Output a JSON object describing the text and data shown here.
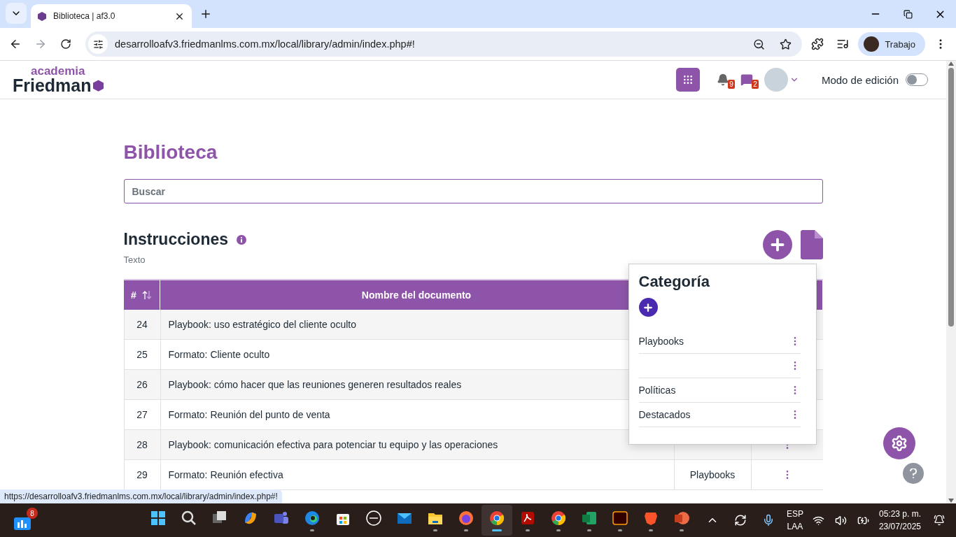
{
  "browser": {
    "tab_title": "Biblioteca | af3.0",
    "url": "desarrolloafv3.friedmanlms.com.mx/local/library/admin/index.php#!",
    "profile": "Trabajo"
  },
  "header": {
    "logo_top": "academia",
    "logo_main": "Friedman",
    "notifications": "9",
    "messages": "2",
    "edit_mode": {
      "label": "Modo de edición",
      "on": false
    }
  },
  "page": {
    "title": "Biblioteca",
    "search": {
      "placeholder": "Buscar"
    },
    "section": {
      "title": "Instrucciones",
      "subtitle": "Texto"
    }
  },
  "table": {
    "columns": [
      {
        "label": "#"
      },
      {
        "label": "Nombre del documento"
      }
    ],
    "rows": [
      {
        "number": "24",
        "name": "Playbook: uso estratégico del cliente oculto"
      },
      {
        "number": "25",
        "name": "Formato: Cliente oculto"
      },
      {
        "number": "26",
        "name": "Playbook: cómo hacer que las reuniones generen resultados reales"
      },
      {
        "number": "27",
        "name": "Formato: Reunión del punto de venta"
      },
      {
        "number": "28",
        "name": "Playbook: comunicación efectiva para potenciar tu equipo y las operaciones",
        "actions_menu": true
      },
      {
        "number": "29",
        "name": "Formato: Reunión efectiva",
        "category": "Playbooks",
        "actions_menu": true
      }
    ]
  },
  "category_popover": {
    "title": "Categoría",
    "items": [
      {
        "kind": "named",
        "label": "Playbooks"
      },
      {
        "kind": "blank"
      },
      {
        "kind": "named",
        "label": "Políticas"
      },
      {
        "kind": "named",
        "label": "Destacados"
      }
    ]
  },
  "status_link": "https://desarrolloafv3.friedmanlms.com.mx/local/library/admin/index.php#!",
  "taskbar": {
    "widgets_badge": "8",
    "language": [
      "ESP",
      "LAA"
    ],
    "time": "05:23 p. m.",
    "date": "23/07/2025",
    "apps": [
      {
        "kind": "windows",
        "running": false,
        "active": false
      },
      {
        "kind": "search",
        "running": false,
        "active": false
      },
      {
        "kind": "taskview",
        "running": false,
        "active": false
      },
      {
        "kind": "copilot",
        "running": false,
        "active": false
      },
      {
        "kind": "teams",
        "running": false,
        "active": false
      },
      {
        "kind": "edge",
        "running": true,
        "active": false
      },
      {
        "kind": "store",
        "running": false,
        "active": false
      },
      {
        "kind": "dell",
        "running": false,
        "active": false
      },
      {
        "kind": "mail",
        "running": false,
        "active": false
      },
      {
        "kind": "folder",
        "running": true,
        "active": false
      },
      {
        "kind": "firefox",
        "running": true,
        "active": false
      },
      {
        "kind": "chrome",
        "running": true,
        "active": true
      },
      {
        "kind": "pdf",
        "running": true,
        "active": false
      },
      {
        "kind": "chrome",
        "running": true,
        "active": false
      },
      {
        "kind": "excel",
        "running": true,
        "active": false
      },
      {
        "kind": "illustrator",
        "running": true,
        "active": false
      },
      {
        "kind": "brave",
        "running": true,
        "active": false
      },
      {
        "kind": "powerpoint",
        "running": true,
        "active": false
      }
    ]
  }
}
